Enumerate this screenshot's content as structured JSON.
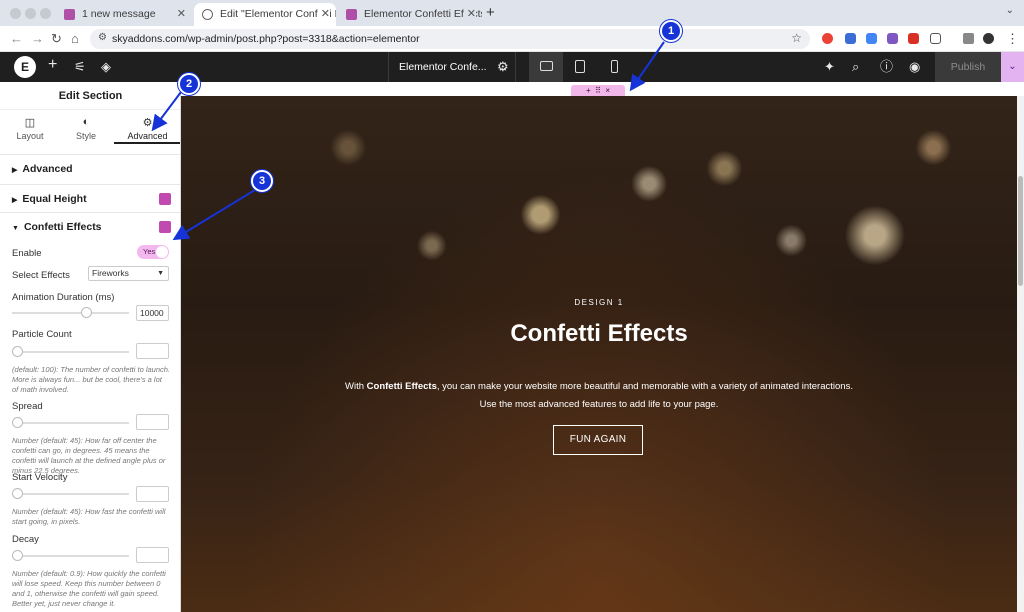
{
  "browser": {
    "tabs": [
      {
        "title": "1 new message"
      },
      {
        "title": "Edit \"Elementor Confetti Effe"
      },
      {
        "title": "Elementor Confetti Effects Ex"
      }
    ],
    "url": "skyaddons.com/wp-admin/post.php?post=3318&action=elementor",
    "icons": [
      "back-icon",
      "forward-icon",
      "reload-icon",
      "home-icon",
      "site-settings-icon",
      "bookmark-star-icon"
    ]
  },
  "editor_top": {
    "logo": "E",
    "document_title": "Elementor Confe...",
    "publish_label": "Publish"
  },
  "panel": {
    "title": "Edit Section",
    "tabs": [
      {
        "label": "Layout",
        "icon": "layout-icon"
      },
      {
        "label": "Style",
        "icon": "style-half-circle-icon"
      },
      {
        "label": "Advanced",
        "icon": "gear-icon"
      }
    ],
    "sections": [
      {
        "label": "Advanced"
      },
      {
        "label": "Equal Height"
      },
      {
        "label": "Confetti Effects"
      }
    ],
    "enable": {
      "label": "Enable",
      "value": "Yes"
    },
    "select_effects": {
      "label": "Select Effects",
      "value": "Fireworks"
    },
    "animation_duration": {
      "label": "Animation Duration (ms)",
      "value": "10000",
      "level": 0.65
    },
    "particle_count": {
      "label": "Particle Count",
      "value": "",
      "help": "(default: 100): The number of confetti to launch. More is always fun... but be cool, there's a lot of math involved.",
      "level": 0
    },
    "spread": {
      "label": "Spread",
      "value": "",
      "help": "Number (default: 45): How far off center the confetti can go, in degrees. 45 means the confetti will launch at the defined angle plus or minus 22.5 degrees.",
      "level": 0
    },
    "start_velocity": {
      "label": "Start Velocity",
      "value": "",
      "help": "Number (default: 45): How fast the confetti will start going, in pixels.",
      "level": 0
    },
    "decay": {
      "label": "Decay",
      "value": "",
      "help": "Number (default: 0.9): How quickly the confetti will lose speed. Keep this number between 0 and 1, otherwise the confetti will gain speed. Better yet, just never change it.",
      "level": 0
    }
  },
  "hero": {
    "eyebrow": "DESIGN 1",
    "heading": "Confetti Effects",
    "para_prefix": "With ",
    "para_bold": "Confetti Effects",
    "para_line1_suffix": ", you can make your website more beautiful and memorable with a variety of animated interactions.",
    "para_line2": "Use the most advanced features to add life to your page.",
    "cta_label": "FUN AGAIN"
  },
  "section_toolbar": {
    "add": "+",
    "drag": "⠿",
    "close": "×"
  },
  "callouts": [
    "1",
    "2",
    "3"
  ],
  "colors": {
    "accent": "#1533d6",
    "elementor_pink": "#f0b7e8",
    "publish_more": "#e2b3f0"
  }
}
